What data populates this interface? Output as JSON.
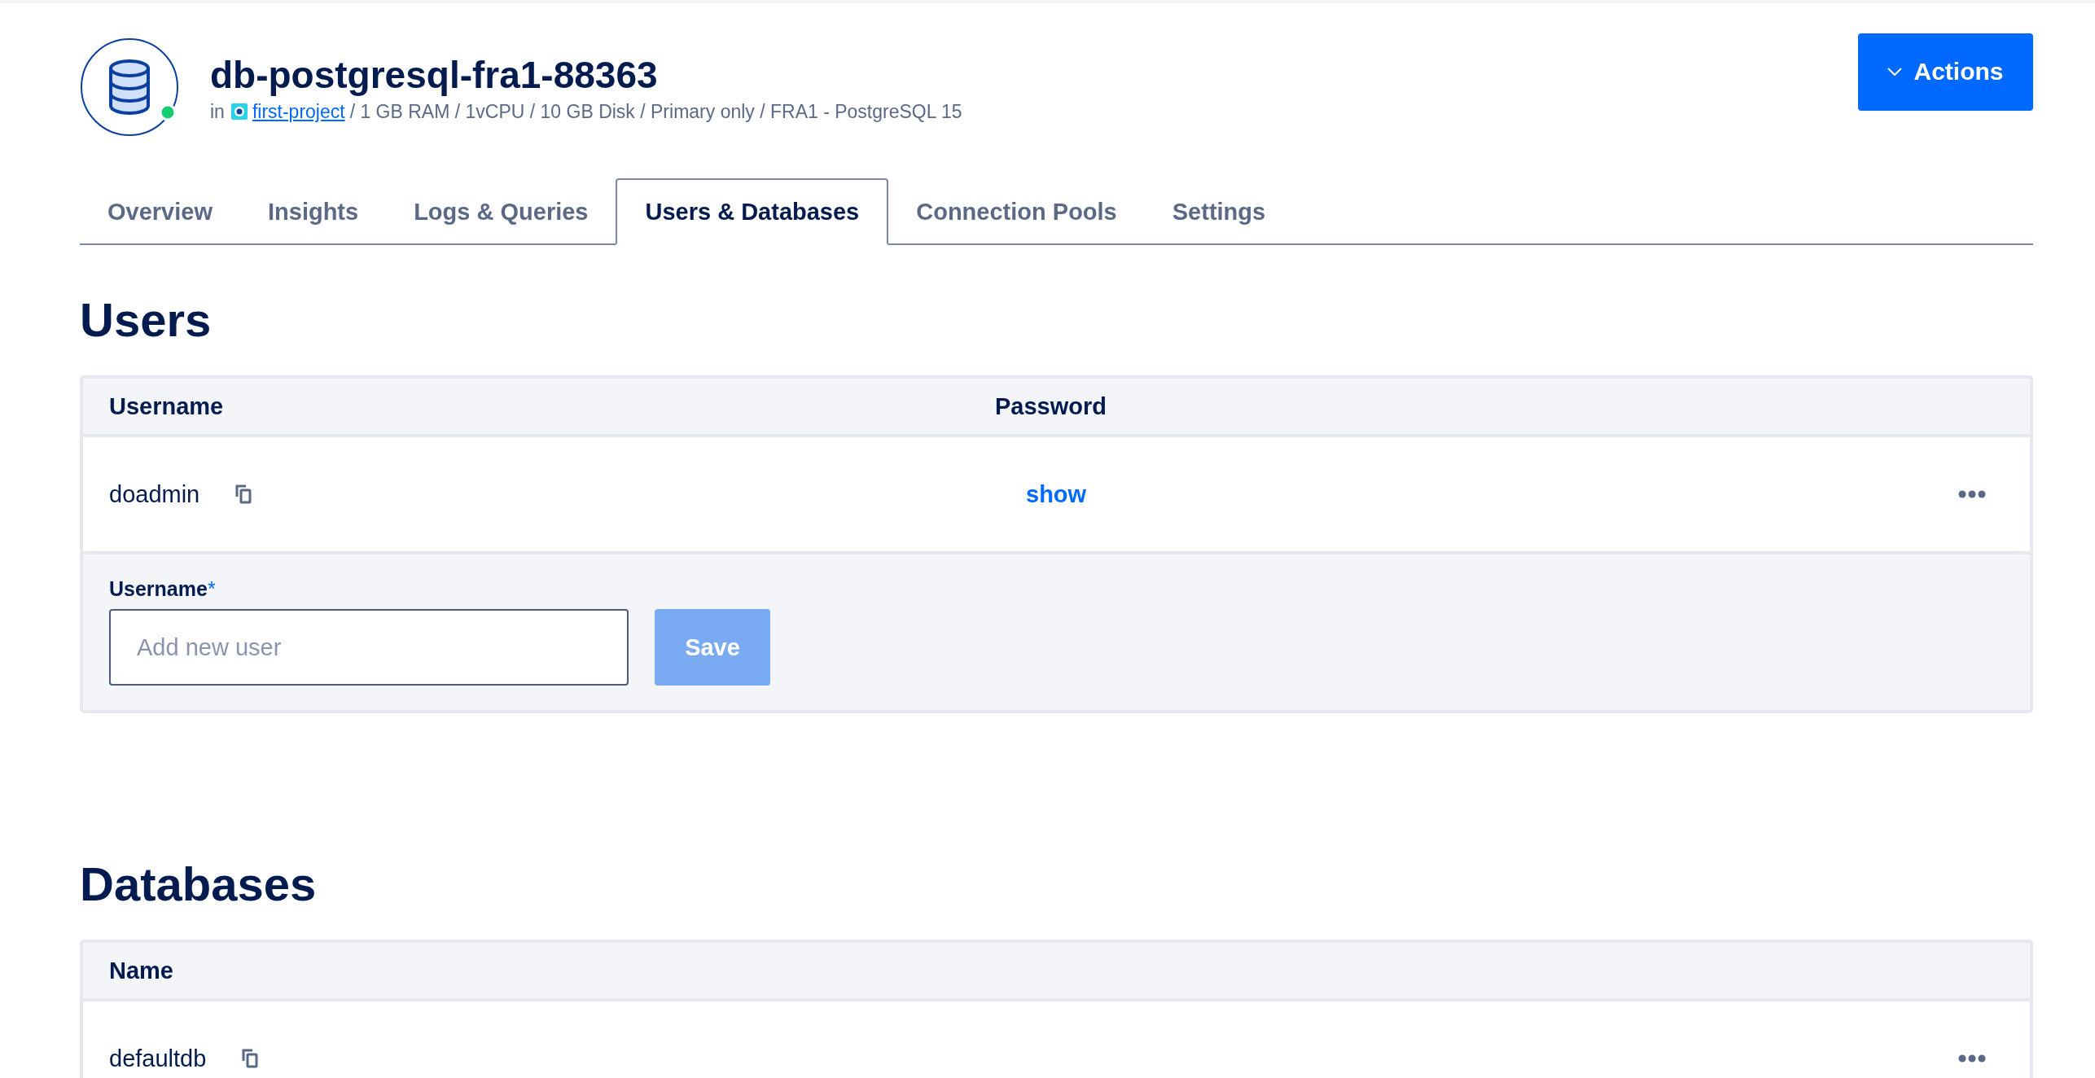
{
  "header": {
    "title": "db-postgresql-fra1-88363",
    "prefix": "in",
    "project": "first-project",
    "details": "/ 1 GB RAM / 1vCPU / 10 GB Disk / Primary only / FRA1 - PostgreSQL 15",
    "actions_button": "Actions"
  },
  "tabs": [
    {
      "label": "Overview",
      "selected": false
    },
    {
      "label": "Insights",
      "selected": false
    },
    {
      "label": "Logs & Queries",
      "selected": false
    },
    {
      "label": "Users & Databases",
      "selected": true
    },
    {
      "label": "Connection Pools",
      "selected": false
    },
    {
      "label": "Settings",
      "selected": false
    }
  ],
  "users": {
    "heading": "Users",
    "columns": [
      "Username",
      "Password"
    ],
    "rows": [
      {
        "username": "doadmin",
        "password_link": "show"
      }
    ],
    "form": {
      "label": "Username",
      "required_mark": "*",
      "placeholder": "Add new user",
      "button": "Save",
      "button_disabled": true
    }
  },
  "databases": {
    "heading": "Databases",
    "columns": [
      "Name"
    ],
    "rows": [
      {
        "name": "defaultdb"
      }
    ]
  }
}
